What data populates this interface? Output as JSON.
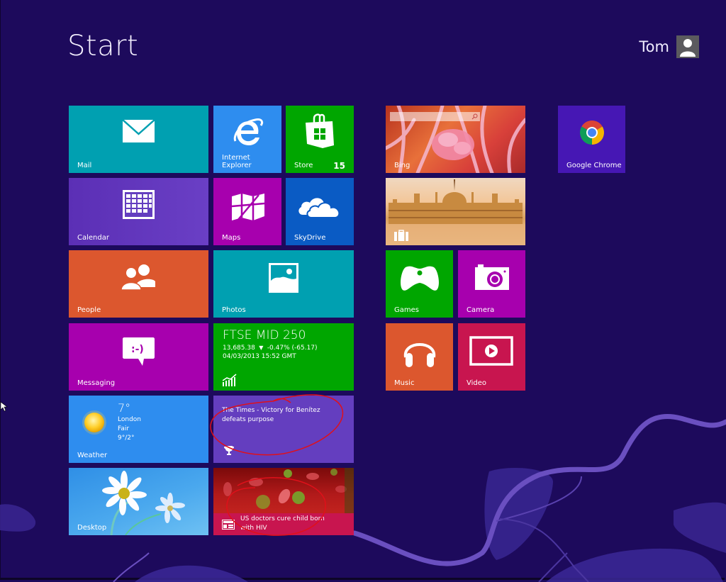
{
  "screen": {
    "title": "Start",
    "user": {
      "name": "Tom"
    }
  },
  "tiles": {
    "mail": {
      "label": "Mail",
      "color": "#00a0b1"
    },
    "ie": {
      "label": "Internet Explorer",
      "color": "#2e8def"
    },
    "store": {
      "label": "Store",
      "badge": "15",
      "color": "#00a600"
    },
    "calendar": {
      "label": "Calendar",
      "color": "#643ebf"
    },
    "maps": {
      "label": "Maps",
      "color": "#a700ae"
    },
    "skydrive": {
      "label": "SkyDrive",
      "color": "#0a5bc4"
    },
    "people": {
      "label": "People",
      "color": "#dc572e"
    },
    "photos": {
      "label": "Photos",
      "color": "#00a0b1"
    },
    "messaging": {
      "label": "Messaging",
      "color": "#a700ae"
    },
    "finance": {
      "index": "FTSE MID 250",
      "value": "13,685.38",
      "change": "-0.47% (-65.17)",
      "timestamp": "04/03/2013 15:52 GMT",
      "color": "#00a600"
    },
    "weather": {
      "label": "Weather",
      "temp": "7°",
      "city": "London",
      "condition": "Fair",
      "range": "9°/2°",
      "color": "#2e8def"
    },
    "sports": {
      "headline": "The Times - Victory for Benítez defeats purpose",
      "color": "#643ebf"
    },
    "desktop": {
      "label": "Desktop"
    },
    "news": {
      "headline_line1": "US doctors cure child born",
      "headline_line2": "with HIV",
      "color": "#c8154f"
    },
    "bing": {
      "label": "Bing"
    },
    "travel": {
      "label": ""
    },
    "games": {
      "label": "Games",
      "color": "#00a600"
    },
    "camera": {
      "label": "Camera",
      "color": "#a700ae"
    },
    "music": {
      "label": "Music",
      "color": "#dc572e"
    },
    "video": {
      "label": "Video",
      "color": "#c8154f"
    },
    "chrome": {
      "label": "Google Chrome",
      "color": "#4617b4"
    }
  },
  "annotations": {
    "circle_color": "#e0101a"
  },
  "background": {
    "color": "#1d0a5c",
    "accent": "#6a4fc0"
  }
}
